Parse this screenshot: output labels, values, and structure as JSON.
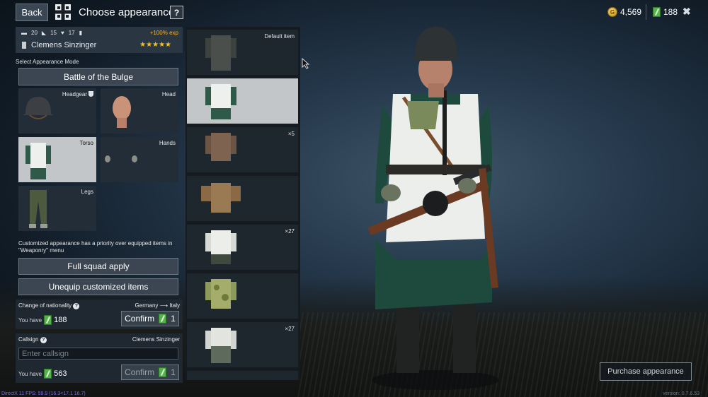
{
  "topbar": {
    "back_label": "Back",
    "title": "Choose appearance",
    "help_label": "?",
    "gold_amount": "4,569",
    "gold_icon": "G",
    "ticket_amount": "188",
    "close_label": "✖"
  },
  "soldier": {
    "stat1": "20",
    "stat2": "15",
    "stat3": "17",
    "exp_bonus": "+100% exp",
    "name": "Clemens Sinzinger",
    "stars": "★★★★★"
  },
  "appearance": {
    "mode_label": "Select Appearance Mode",
    "mode_value": "Battle of the Bulge",
    "slots": {
      "headgear": "Headgear",
      "head": "Head",
      "torso": "Torso",
      "hands": "Hands",
      "legs": "Legs"
    },
    "note": "Customized appearance has a priority over equipped items in \"Weaponry\" menu",
    "full_squad_apply": "Full squad apply",
    "unequip": "Unequip customized items"
  },
  "nationality": {
    "title": "Change of nationality",
    "change": "Germany ⟶ Italy",
    "you_have": "You have",
    "amount": "188",
    "confirm": "Confirm",
    "cost": "1"
  },
  "callsign": {
    "title": "Callsign",
    "current": "Clemens Sinzinger",
    "placeholder": "Enter callsign",
    "you_have": "You have",
    "amount": "563",
    "confirm": "Confirm",
    "cost": "1"
  },
  "items": [
    {
      "label": "Default item"
    },
    {
      "label": ""
    },
    {
      "label": "×5"
    },
    {
      "label": ""
    },
    {
      "label": "×27"
    },
    {
      "label": ""
    },
    {
      "label": "×27"
    }
  ],
  "purchase_label": "Purchase appearance",
  "fps_text": "DirectX 11 FPS: 59.9 (16.3<17.1 16.7)",
  "version_text": "version: 0.7.6.53",
  "colors": {
    "accent_gold": "#f2b640",
    "ticket_green": "#56b24c",
    "selected_slot": "#c3c6c8"
  }
}
